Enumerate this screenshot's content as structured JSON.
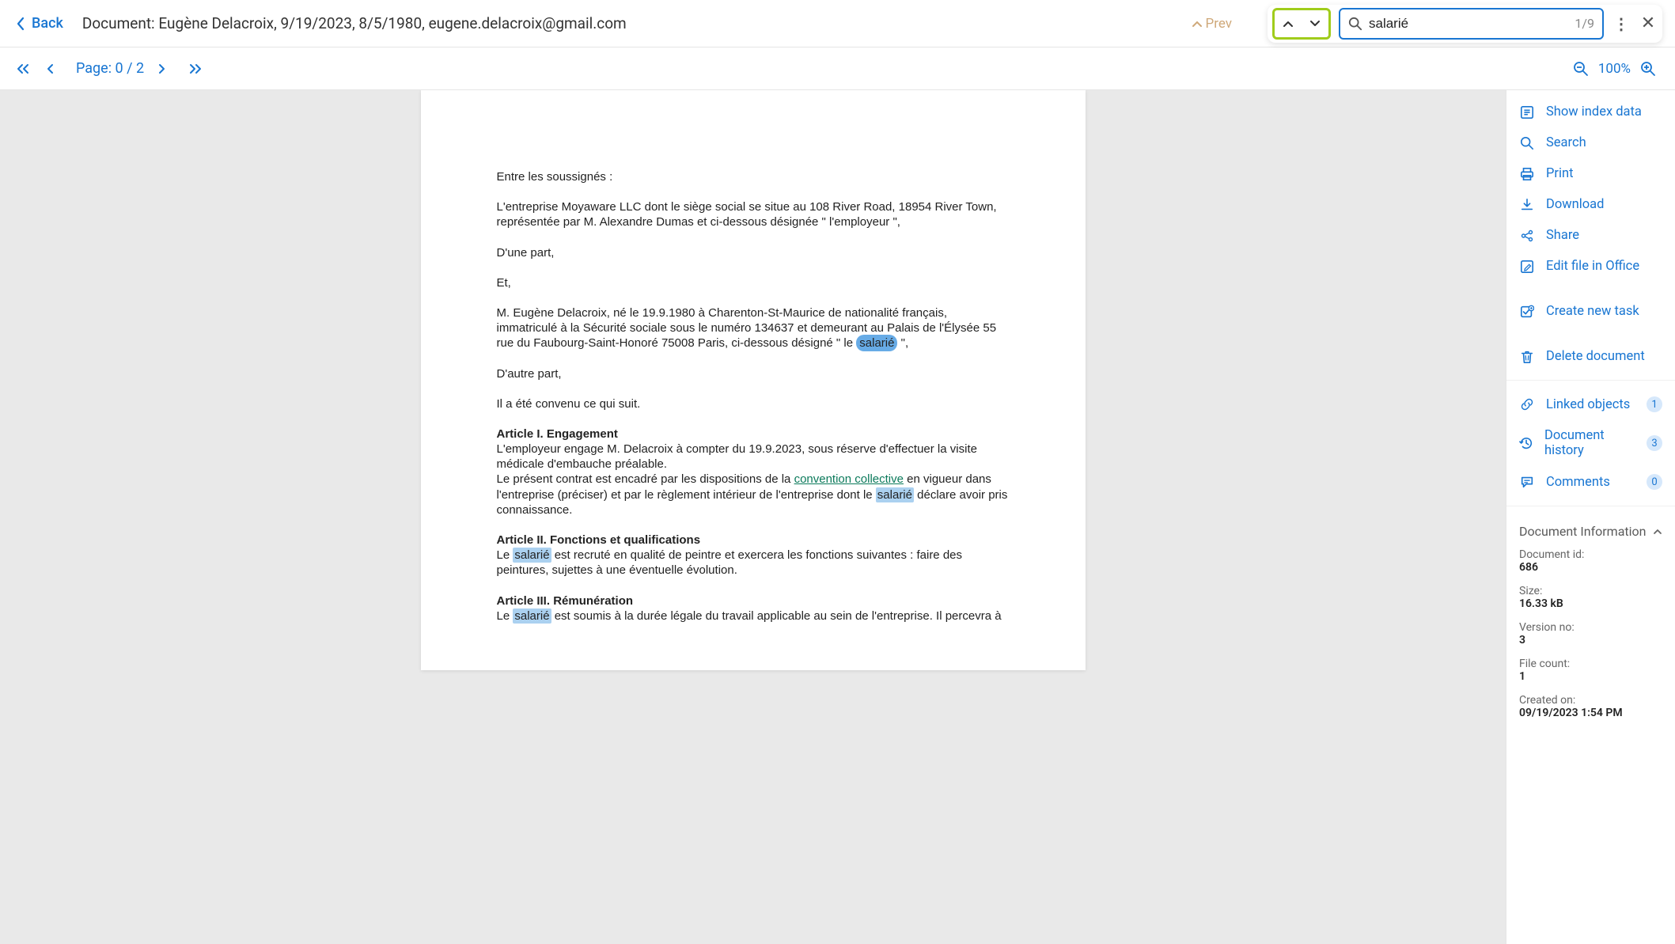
{
  "header": {
    "back_label": "Back",
    "title": "Document: Eugène Delacroix, 9/19/2023, 8/5/1980, eugene.delacroix@gmail.com",
    "prev_faded": "Prev"
  },
  "search": {
    "query": "salarié",
    "count": "1/9"
  },
  "pager": {
    "label": "Page: 0 / 2",
    "zoom": "100%"
  },
  "doc": {
    "p1": "Entre les soussignés :",
    "p2": "L'entreprise Moyaware LLC dont le siège social se situe au 108 River Road, 18954 River Town, représentée par M. Alexandre Dumas et ci-dessous désignée \" l'employeur \",",
    "p3": "D'une part,",
    "p4": "Et,",
    "p5a": "M. Eugène Delacroix, né le 19.9.1980 à Charenton-St-Maurice de nationalité français, immatriculé à la Sécurité sociale sous le numéro 134637 et demeurant au Palais de l'Élysée 55 rue du Faubourg-Saint-Honoré 75008 Paris, ci-dessous désigné \" le ",
    "p5_hl": "salarié",
    "p5b": " \",",
    "p6": "D'autre part,",
    "p7": "Il a été convenu ce qui suit.",
    "a1_title": "Article I. Engagement",
    "a1_l1": "L'employeur engage M. Delacroix à compter du 19.9.2023, sous réserve d'effectuer la visite médicale d'embauche préalable.",
    "a1_l2a": "Le présent contrat est encadré par les dispositions de la ",
    "a1_link": "convention collective",
    "a1_l2b": " en vigueur dans l'entreprise (préciser) et par le règlement intérieur de l'entreprise dont le ",
    "a1_hl": "salarié",
    "a1_l2c": " déclare avoir pris connaissance.",
    "a2_title": "Article II. Fonctions et qualifications",
    "a2_l1a": "Le ",
    "a2_hl": "salarié",
    "a2_l1b": " est recruté en qualité de peintre et exercera les fonctions suivantes : faire des peintures, sujettes à une éventuelle évolution.",
    "a3_title": "Article III. Rémunération",
    "a3_l1a": "Le ",
    "a3_hl": "salarié",
    "a3_l1b": " est soumis à la durée légale du travail applicable au sein de l'entreprise. Il percevra à"
  },
  "sidebar": {
    "show_index": "Show index data",
    "search": "Search",
    "print": "Print",
    "download": "Download",
    "share": "Share",
    "edit_office": "Edit file in Office",
    "create_task": "Create new task",
    "delete_doc": "Delete document",
    "linked_objects": "Linked objects",
    "linked_objects_count": "1",
    "doc_history": "Document history",
    "doc_history_count": "3",
    "comments": "Comments",
    "comments_count": "0",
    "info_header": "Document Information",
    "info": {
      "id_label": "Document id:",
      "id_value": "686",
      "size_label": "Size:",
      "size_value": "16.33 kB",
      "version_label": "Version no:",
      "version_value": "3",
      "filecount_label": "File count:",
      "filecount_value": "1",
      "created_label": "Created on:",
      "created_value": "09/19/2023 1:54 PM"
    }
  }
}
